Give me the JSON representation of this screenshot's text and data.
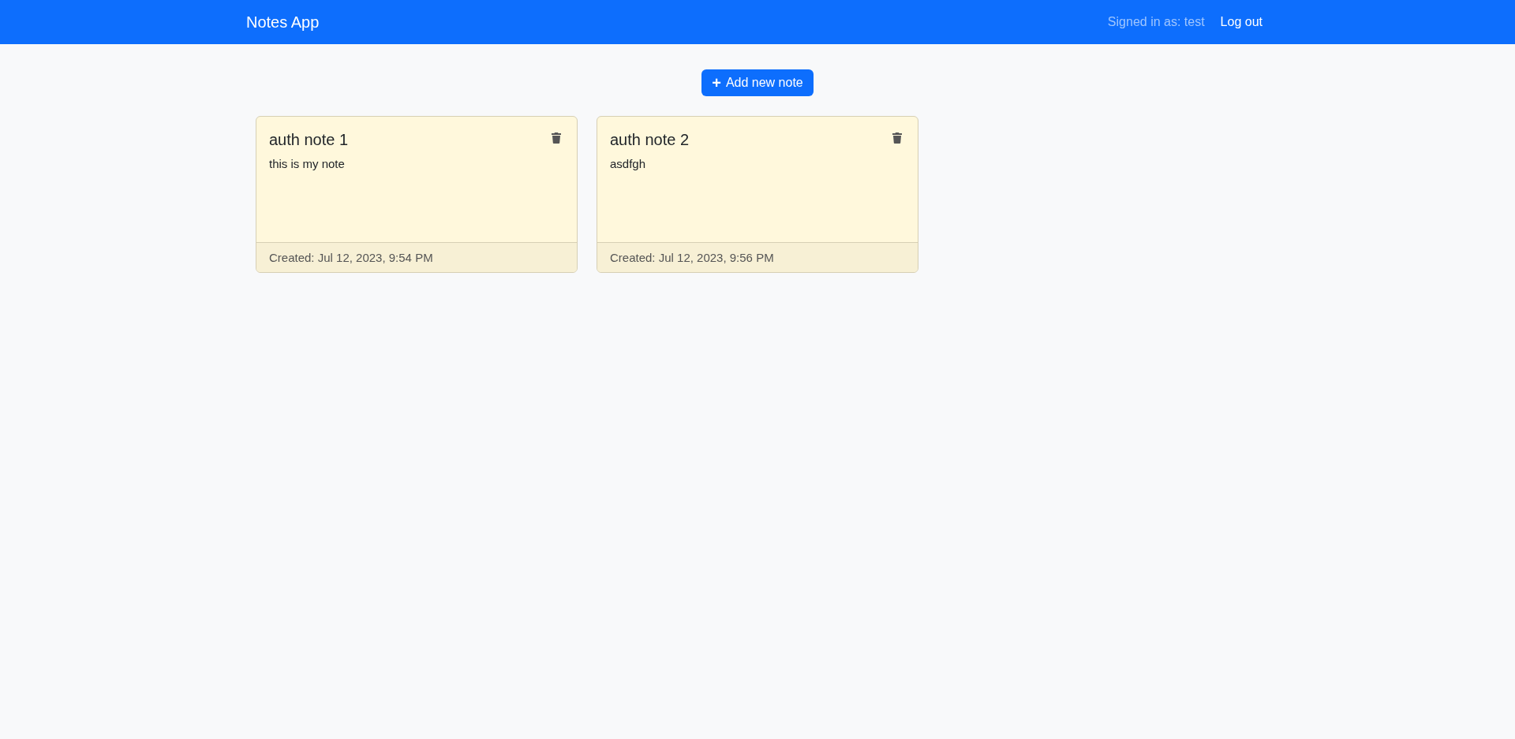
{
  "navbar": {
    "brand": "Notes App",
    "signed_in": "Signed in as: test",
    "logout": "Log out"
  },
  "add_button": {
    "icon": "+",
    "label": "Add new note"
  },
  "notes": [
    {
      "title": "auth note 1",
      "body": "this is my note",
      "created": "Created: Jul 12, 2023, 9:54 PM"
    },
    {
      "title": "auth note 2",
      "body": "asdfgh",
      "created": "Created: Jul 12, 2023, 9:56 PM"
    }
  ]
}
